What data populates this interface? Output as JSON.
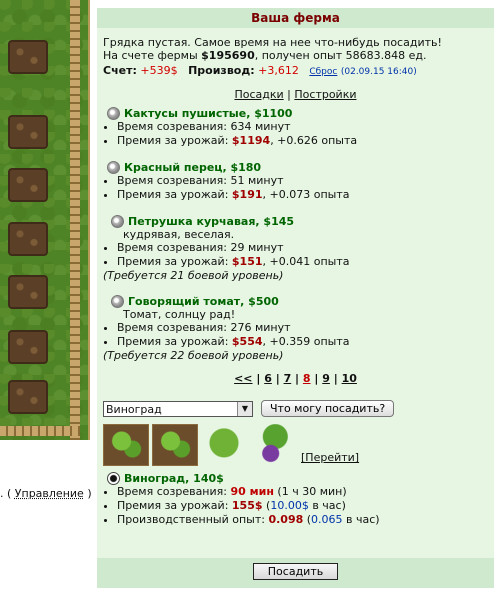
{
  "panel": {
    "title": "Ваша ферма",
    "intro_line1": "Грядка пустая. Самое время на нее что-нибудь посадить!",
    "intro_line2_a": "На счете фермы ",
    "intro_money": "$195690",
    "intro_line2_b": ", получен опыт 58683.848 ед.",
    "account_label": "Счет:",
    "account_value": "+539$",
    "production_label": "Производ:",
    "production_value": "+3,612",
    "reset_label": "Сброс",
    "reset_date": "(02.09.15 16:40)"
  },
  "tabs": {
    "plantings": "Посадки",
    "separator": "|",
    "buildings": "Постройки"
  },
  "plants": [
    {
      "name": "Кактусы пушистые",
      "price": " , $1100",
      "time_label": "Время созревания: ",
      "time": "634 минут",
      "reward_label": "Премия за урожай: ",
      "reward": "$1194",
      "exp": ", +0.626 опыта"
    },
    {
      "name": "Красный перец",
      "price": ", $180",
      "time_label": "Время созревания: ",
      "time": "51 минут",
      "reward_label": "Премия за урожай: ",
      "reward": "$191",
      "exp": ", +0.073 опыта"
    },
    {
      "name": "Петрушка курчавая",
      "price": " , $145",
      "desc": "кудрявая, веселая.",
      "time_label": "Время созревания: ",
      "time": "29 минут",
      "reward_label": "Премия за урожай: ",
      "reward": "$151",
      "exp": ", +0.041 опыта",
      "req": "(Требуется 21 боевой уровень)"
    },
    {
      "name": "Говорящий томат",
      "price": ", $500",
      "desc": "Томат, солнцу рад!",
      "time_label": "Время созревания: ",
      "time": "276 минут",
      "reward_label": "Премия за урожай: ",
      "reward": "$554",
      "exp": ", +0.359 опыта",
      "req": "(Требуется 22 боевой уровень)"
    }
  ],
  "pager": {
    "prev": "<<",
    "pages": [
      "6",
      "7",
      "8",
      "9",
      "10"
    ],
    "current": "8"
  },
  "select": {
    "value": "Виноград",
    "button": "Что могу посадить?"
  },
  "go_link": "[Перейти]",
  "selected": {
    "name": "Виноград, 140$",
    "time_label": "Время созревания: ",
    "time": "90 мин",
    "time_extra": " (1 ч 30 мин)",
    "reward_label": "Премия за урожай: ",
    "reward": "155$",
    "reward_rate_open": " (",
    "reward_rate": "10.00$",
    "reward_rate_close": " в час)",
    "exp_label": "Производственный опыт: ",
    "exp": "0.098",
    "exp_rate_open": " (",
    "exp_rate": "0.065",
    "exp_rate_close": " в час)"
  },
  "plant_button": "Посадить",
  "bottom_left": {
    "prefix": ". (",
    "link": "Управление",
    "suffix": ")"
  }
}
